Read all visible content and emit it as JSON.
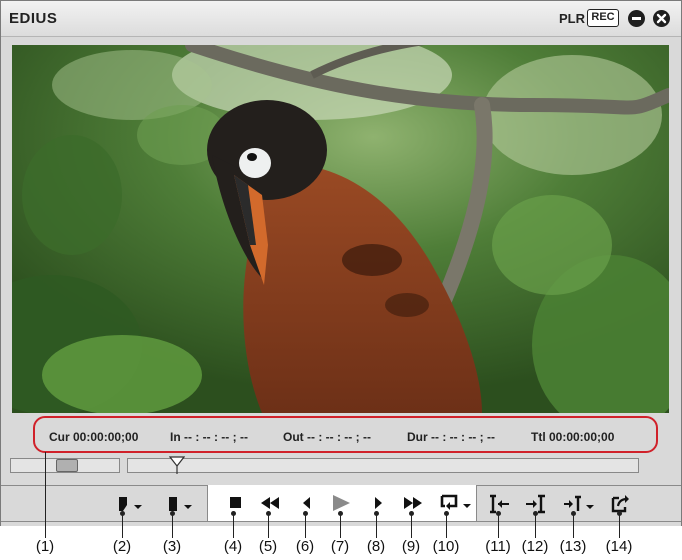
{
  "window": {
    "title": "EDIUS",
    "plr_label": "PLR",
    "rec_label": "REC",
    "minimize_icon": "minimize-icon",
    "close_icon": "close-icon"
  },
  "viewer": {
    "image_description_icon": "video-frame"
  },
  "timecode": {
    "cur": "Cur 00:00:00;00",
    "in": "In -- : -- : -- ; --",
    "out": "Out -- : -- : -- ; --",
    "dur": "Dur -- : -- : -- ; --",
    "ttl": "Ttl 00:00:00;00"
  },
  "controls": {
    "left": [
      {
        "icon": "set-in-point-icon",
        "has_dropdown": true
      },
      {
        "icon": "set-out-point-icon",
        "has_dropdown": true
      }
    ],
    "transport": [
      {
        "icon": "stop-icon"
      },
      {
        "icon": "rewind-icon"
      },
      {
        "icon": "previous-frame-icon"
      },
      {
        "icon": "play-icon"
      },
      {
        "icon": "next-frame-icon"
      },
      {
        "icon": "fast-forward-icon"
      },
      {
        "icon": "loop-playback-icon",
        "has_dropdown": true
      }
    ],
    "right": [
      {
        "icon": "insert-to-timeline-icon"
      },
      {
        "icon": "overwrite-to-timeline-icon"
      },
      {
        "icon": "export-icon",
        "has_dropdown": true
      },
      {
        "icon": "show-in-bin-icon"
      }
    ]
  },
  "callouts": [
    "(1)",
    "(2)",
    "(3)",
    "(4)",
    "(5)",
    "(6)",
    "(7)",
    "(8)",
    "(9)",
    "(10)",
    "(11)",
    "(12)",
    "(13)",
    "(14)"
  ],
  "colors": {
    "callout_frame": "#d0212a",
    "play_icon": "#8a8a8a"
  }
}
